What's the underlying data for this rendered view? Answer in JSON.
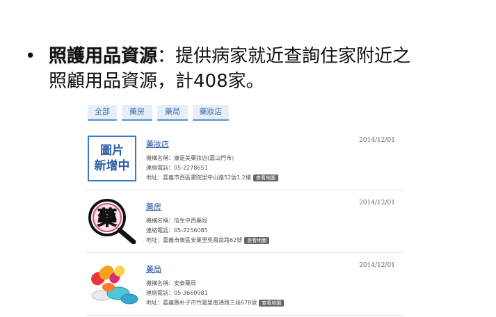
{
  "bullet": {
    "dot": "•",
    "strong": "照護用品資源",
    "rest": "：提供病家就近查詢住家附近之",
    "line2": "照顧用品資源，計408家。"
  },
  "tabs": [
    {
      "label": "全部"
    },
    {
      "label": "藥房"
    },
    {
      "label": "藥局"
    },
    {
      "label": "藥妝店"
    }
  ],
  "map_button_label": "查看地圖",
  "items": [
    {
      "title": "藥妝店",
      "date": "2014/12/01",
      "org": "機構名稱：康是美藥妝店(嘉山門市)",
      "phone": "連絡電話：05-2278651",
      "address": "地址：嘉義市西區書院里中山路52號1,2樓",
      "placeholder_line1": "圖片",
      "placeholder_line2": "新增中",
      "icon": "image-placeholder"
    },
    {
      "title": "藥房",
      "date": "2014/12/01",
      "org": "機構名稱：信生中西藥局",
      "phone": "連絡電話：05-2256085",
      "address": "地址：嘉義市東區安業里吳鳳南路62號",
      "icon": "pharmacy-magnifier",
      "icon_glyph": "藥"
    },
    {
      "title": "藥局",
      "date": "2014/12/01",
      "org": "機構名稱：安泰藥局",
      "phone": "連絡電話：05-3660981",
      "address": "地址：嘉義縣朴子市竹圍里南通路三段678號",
      "icon": "pills"
    }
  ]
}
